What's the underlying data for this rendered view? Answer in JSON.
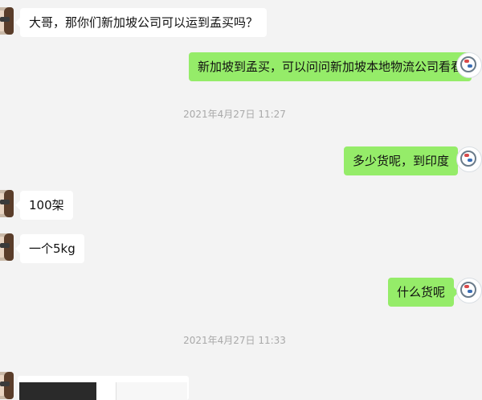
{
  "conversation": {
    "messages": [
      {
        "side": "left",
        "text": "大哥，那你们新加坡公司可以运到孟买吗？"
      },
      {
        "side": "right",
        "text": "新加坡到孟买，可以问问新加坡本地物流公司看看"
      },
      {
        "side": "right",
        "text": "多少货呢，到印度"
      },
      {
        "side": "left",
        "text": "100架"
      },
      {
        "side": "left",
        "text": "一个5kg"
      },
      {
        "side": "right",
        "text": "什么货呢"
      }
    ],
    "timestamps": [
      "2021年4月27日 11:27",
      "2021年4月27日 11:33"
    ],
    "icons": {
      "contact_avatar": "contact-avatar",
      "self_avatar": "self-avatar",
      "image_message": "image-thumbnail"
    },
    "colors": {
      "background": "#f3f3f3",
      "incoming_bubble": "#ffffff",
      "outgoing_bubble": "#95ec69",
      "timestamp_text": "#a9a9a9"
    }
  }
}
